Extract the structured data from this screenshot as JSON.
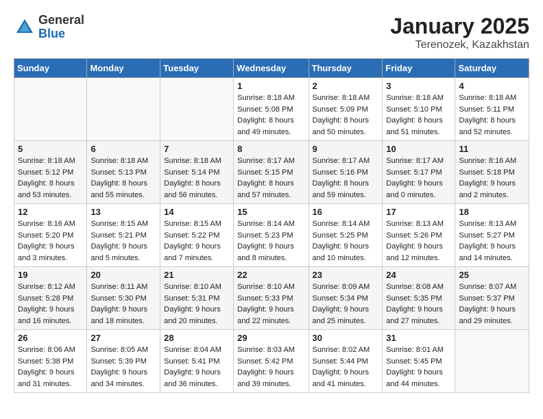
{
  "header": {
    "logo_general": "General",
    "logo_blue": "Blue",
    "month_title": "January 2025",
    "location": "Terenozek, Kazakhstan"
  },
  "weekdays": [
    "Sunday",
    "Monday",
    "Tuesday",
    "Wednesday",
    "Thursday",
    "Friday",
    "Saturday"
  ],
  "weeks": [
    [
      {
        "day": "",
        "sunrise": "",
        "sunset": "",
        "daylight": ""
      },
      {
        "day": "",
        "sunrise": "",
        "sunset": "",
        "daylight": ""
      },
      {
        "day": "",
        "sunrise": "",
        "sunset": "",
        "daylight": ""
      },
      {
        "day": "1",
        "sunrise": "8:18 AM",
        "sunset": "5:08 PM",
        "daylight": "8 hours and 49 minutes."
      },
      {
        "day": "2",
        "sunrise": "8:18 AM",
        "sunset": "5:09 PM",
        "daylight": "8 hours and 50 minutes."
      },
      {
        "day": "3",
        "sunrise": "8:18 AM",
        "sunset": "5:10 PM",
        "daylight": "8 hours and 51 minutes."
      },
      {
        "day": "4",
        "sunrise": "8:18 AM",
        "sunset": "5:11 PM",
        "daylight": "8 hours and 52 minutes."
      }
    ],
    [
      {
        "day": "5",
        "sunrise": "8:18 AM",
        "sunset": "5:12 PM",
        "daylight": "8 hours and 53 minutes."
      },
      {
        "day": "6",
        "sunrise": "8:18 AM",
        "sunset": "5:13 PM",
        "daylight": "8 hours and 55 minutes."
      },
      {
        "day": "7",
        "sunrise": "8:18 AM",
        "sunset": "5:14 PM",
        "daylight": "8 hours and 56 minutes."
      },
      {
        "day": "8",
        "sunrise": "8:17 AM",
        "sunset": "5:15 PM",
        "daylight": "8 hours and 57 minutes."
      },
      {
        "day": "9",
        "sunrise": "8:17 AM",
        "sunset": "5:16 PM",
        "daylight": "8 hours and 59 minutes."
      },
      {
        "day": "10",
        "sunrise": "8:17 AM",
        "sunset": "5:17 PM",
        "daylight": "9 hours and 0 minutes."
      },
      {
        "day": "11",
        "sunrise": "8:16 AM",
        "sunset": "5:18 PM",
        "daylight": "9 hours and 2 minutes."
      }
    ],
    [
      {
        "day": "12",
        "sunrise": "8:16 AM",
        "sunset": "5:20 PM",
        "daylight": "9 hours and 3 minutes."
      },
      {
        "day": "13",
        "sunrise": "8:15 AM",
        "sunset": "5:21 PM",
        "daylight": "9 hours and 5 minutes."
      },
      {
        "day": "14",
        "sunrise": "8:15 AM",
        "sunset": "5:22 PM",
        "daylight": "9 hours and 7 minutes."
      },
      {
        "day": "15",
        "sunrise": "8:14 AM",
        "sunset": "5:23 PM",
        "daylight": "9 hours and 8 minutes."
      },
      {
        "day": "16",
        "sunrise": "8:14 AM",
        "sunset": "5:25 PM",
        "daylight": "9 hours and 10 minutes."
      },
      {
        "day": "17",
        "sunrise": "8:13 AM",
        "sunset": "5:26 PM",
        "daylight": "9 hours and 12 minutes."
      },
      {
        "day": "18",
        "sunrise": "8:13 AM",
        "sunset": "5:27 PM",
        "daylight": "9 hours and 14 minutes."
      }
    ],
    [
      {
        "day": "19",
        "sunrise": "8:12 AM",
        "sunset": "5:28 PM",
        "daylight": "9 hours and 16 minutes."
      },
      {
        "day": "20",
        "sunrise": "8:11 AM",
        "sunset": "5:30 PM",
        "daylight": "9 hours and 18 minutes."
      },
      {
        "day": "21",
        "sunrise": "8:10 AM",
        "sunset": "5:31 PM",
        "daylight": "9 hours and 20 minutes."
      },
      {
        "day": "22",
        "sunrise": "8:10 AM",
        "sunset": "5:33 PM",
        "daylight": "9 hours and 22 minutes."
      },
      {
        "day": "23",
        "sunrise": "8:09 AM",
        "sunset": "5:34 PM",
        "daylight": "9 hours and 25 minutes."
      },
      {
        "day": "24",
        "sunrise": "8:08 AM",
        "sunset": "5:35 PM",
        "daylight": "9 hours and 27 minutes."
      },
      {
        "day": "25",
        "sunrise": "8:07 AM",
        "sunset": "5:37 PM",
        "daylight": "9 hours and 29 minutes."
      }
    ],
    [
      {
        "day": "26",
        "sunrise": "8:06 AM",
        "sunset": "5:38 PM",
        "daylight": "9 hours and 31 minutes."
      },
      {
        "day": "27",
        "sunrise": "8:05 AM",
        "sunset": "5:39 PM",
        "daylight": "9 hours and 34 minutes."
      },
      {
        "day": "28",
        "sunrise": "8:04 AM",
        "sunset": "5:41 PM",
        "daylight": "9 hours and 36 minutes."
      },
      {
        "day": "29",
        "sunrise": "8:03 AM",
        "sunset": "5:42 PM",
        "daylight": "9 hours and 39 minutes."
      },
      {
        "day": "30",
        "sunrise": "8:02 AM",
        "sunset": "5:44 PM",
        "daylight": "9 hours and 41 minutes."
      },
      {
        "day": "31",
        "sunrise": "8:01 AM",
        "sunset": "5:45 PM",
        "daylight": "9 hours and 44 minutes."
      },
      {
        "day": "",
        "sunrise": "",
        "sunset": "",
        "daylight": ""
      }
    ]
  ]
}
